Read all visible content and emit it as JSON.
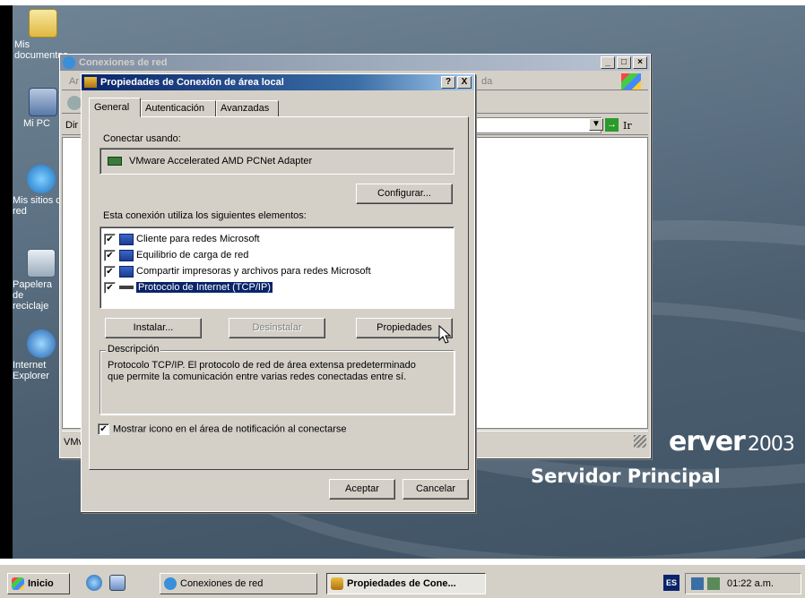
{
  "desktop": {
    "icons": [
      {
        "label": "Mis documentos"
      },
      {
        "label": "Mi PC"
      },
      {
        "label": "Mis sitios de red"
      },
      {
        "label": "Papelera de reciclaje"
      },
      {
        "label": "Internet Explorer"
      }
    ],
    "brand_line1": "erver",
    "brand_year": "2003",
    "brand_line2": "Servidor Principal"
  },
  "back_window": {
    "title": "Conexiones de red",
    "menu_partial": "Ar",
    "menu_partial_right": "da",
    "address_label": "Dir",
    "go_label": "Ir",
    "status_partial": "VMv"
  },
  "dialog": {
    "title": "Propiedades de Conexión de área local",
    "help_btn": "?",
    "close_btn": "X",
    "tabs": [
      "General",
      "Autenticación",
      "Avanzadas"
    ],
    "connect_using_label": "Conectar usando:",
    "adapter": "VMware Accelerated AMD PCNet Adapter",
    "configure_btn": "Configurar...",
    "elements_label": "Esta conexión utiliza los siguientes elementos:",
    "components": [
      {
        "label": "Cliente para redes Microsoft",
        "checked": true,
        "selected": false
      },
      {
        "label": "Equilibrio de carga de red",
        "checked": true,
        "selected": false
      },
      {
        "label": "Compartir impresoras y archivos para redes Microsoft",
        "checked": true,
        "selected": false
      },
      {
        "label": "Protocolo de Internet (TCP/IP)",
        "checked": true,
        "selected": true
      }
    ],
    "install_btn": "Instalar...",
    "uninstall_btn": "Desinstalar",
    "properties_btn": "Propiedades",
    "description_legend": "Descripción",
    "description_text": "Protocolo TCP/IP. El protocolo de red de área extensa predeterminado que permite la comunicación entre varias redes conectadas entre sí.",
    "show_icon_label": "Mostrar icono en el área de notificación al conectarse",
    "show_icon_checked": true,
    "ok_btn": "Aceptar",
    "cancel_btn": "Cancelar"
  },
  "taskbar": {
    "start_label": "Inicio",
    "tasks": [
      {
        "label": "Conexiones de red",
        "active": false
      },
      {
        "label": "Propiedades de Cone...",
        "active": true
      }
    ],
    "lang": "ES",
    "clock": "01:22 a.m."
  },
  "colors": {
    "titlebar_active": "#0a246a",
    "titlebar_inactive": "#7f8ea2",
    "face": "#d4d0c8",
    "selection": "#0a246a"
  }
}
